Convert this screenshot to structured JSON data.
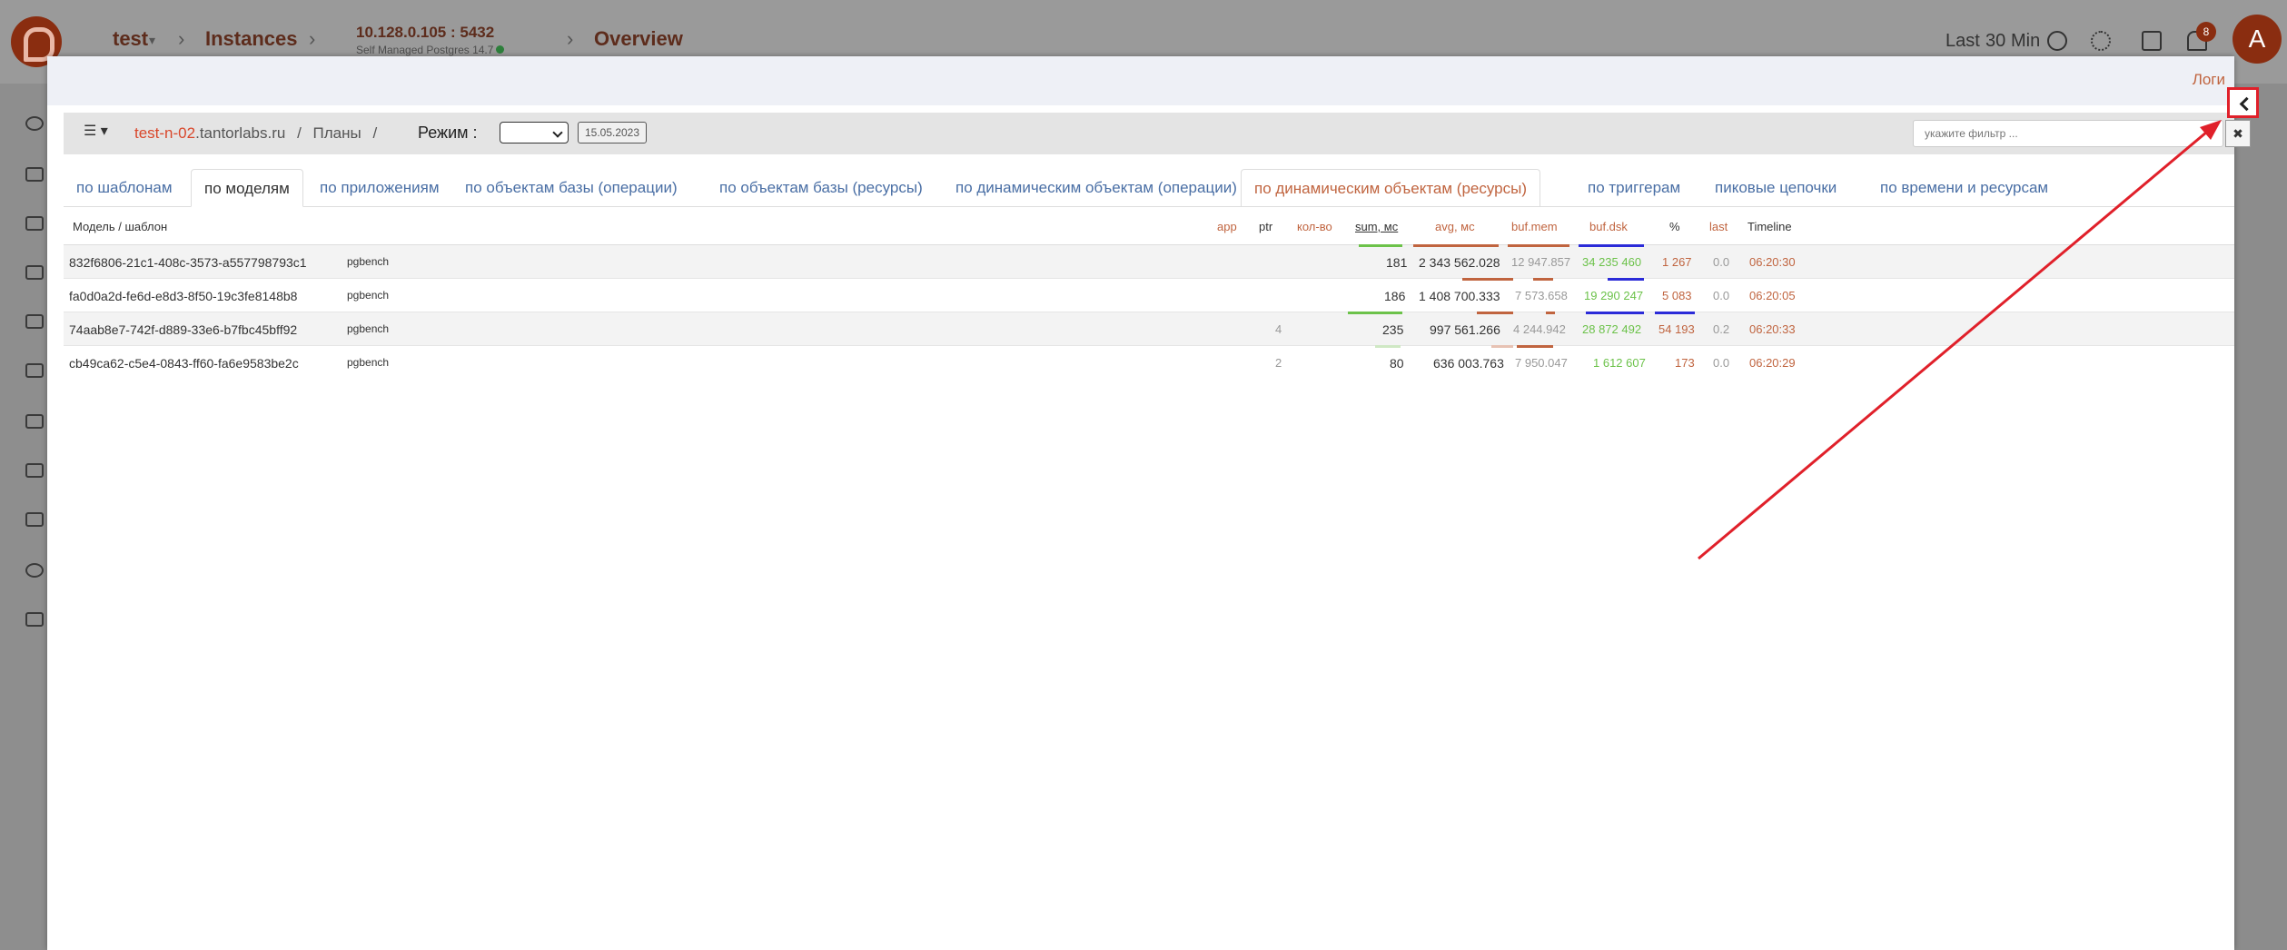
{
  "header": {
    "project": "test",
    "instances": "Instances",
    "connection": "10.128.0.105 : 5432",
    "connection_sub": "Self Managed Postgres 14.7",
    "page": "Overview",
    "range_last": "Last",
    "range_value": "30",
    "range_unit": "Min",
    "notifications_count": "8",
    "avatar_letter": "A"
  },
  "modal": {
    "logs_link": "Логи",
    "host_highlight": "test-n-02",
    "host_rest": ".tantorlabs.ru",
    "breadcrumb_sep1": "/",
    "breadcrumb_plans": "Планы",
    "breadcrumb_sep2": "/",
    "mode_label": "Режим :",
    "date": "15.05.2023",
    "filter_placeholder": "укажите фильтр ...",
    "filter_clear": "✖"
  },
  "tabs": [
    {
      "label": "по шаблонам"
    },
    {
      "label": "по моделям"
    },
    {
      "label": "по приложениям"
    },
    {
      "label": "по объектам базы (операции)"
    },
    {
      "label": "по объектам базы (ресурсы)"
    },
    {
      "label": "по динамическим объектам (операции)"
    },
    {
      "label": "по динамическим объектам (ресурсы)"
    },
    {
      "label": "по триггерам"
    },
    {
      "label": "пиковые цепочки"
    },
    {
      "label": "по времени и ресурсам"
    }
  ],
  "columns": {
    "model": "Модель / шаблон",
    "app": "app",
    "ptr": "ptr",
    "count": "кол-во",
    "sum": "sum, мс",
    "avg": "avg, мс",
    "bufmem": "buf.mem",
    "bufdsk": "buf.dsk",
    "pct": "%",
    "last": "last",
    "timeline": "Timeline"
  },
  "rows": [
    {
      "model": "832f6806-21c1-408c-3573-a557798793c1",
      "app": "pgbench",
      "ptr": "",
      "sum": "181",
      "avg": "2 343 562.028",
      "bufmem": "12 947.857",
      "bufdsk": "34 235 460",
      "pct": "1 267",
      "last": "0.0",
      "timeline": "06:20:30"
    },
    {
      "model": "fa0d0a2d-fe6d-e8d3-8f50-19c3fe8148b8",
      "app": "pgbench",
      "ptr": "",
      "sum": "186",
      "avg": "1 408 700.333",
      "bufmem": "7 573.658",
      "bufdsk": "19 290 247",
      "pct": "5 083",
      "last": "0.0",
      "timeline": "06:20:05"
    },
    {
      "model": "74aab8e7-742f-d889-33e6-b7fbc45bff92",
      "app": "pgbench",
      "ptr": "4",
      "sum": "235",
      "avg": "997 561.266",
      "bufmem": "4 244.942",
      "bufdsk": "28 872 492",
      "pct": "54 193",
      "last": "0.2",
      "timeline": "06:20:33"
    },
    {
      "model": "cb49ca62-c5e4-0843-ff60-fa6e9583be2c",
      "app": "pgbench",
      "ptr": "2",
      "sum": "80",
      "avg": "636 003.763",
      "bufmem": "7 950.047",
      "bufdsk": "1 612 607",
      "pct": "173",
      "last": "0.0",
      "timeline": "06:20:29"
    }
  ],
  "colors": {
    "accent": "#c0643f",
    "highlight": "#e0202a",
    "link": "#4a6fa5"
  }
}
